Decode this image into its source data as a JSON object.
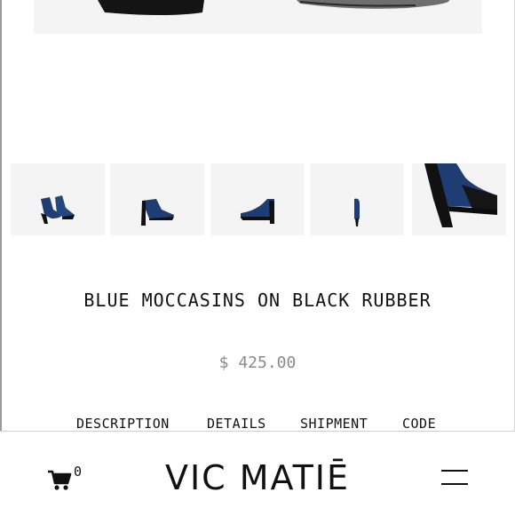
{
  "product": {
    "title": "BLUE MOCCASINS ON BLACK RUBBER",
    "price": "$ 425.00"
  },
  "gallery": {
    "thumbnail_count": 5,
    "colors": {
      "leather_blue": "#1f3c73",
      "rubber_black": "#111111",
      "tile_bg": "#f4f4f4"
    }
  },
  "tabs": [
    {
      "label": "DESCRIPTION"
    },
    {
      "label": "DETAILS"
    },
    {
      "label": "SHIPMENT"
    },
    {
      "label": "CODE"
    }
  ],
  "footer": {
    "cart_icon": "cart-icon",
    "cart_count": "0",
    "brand": "VIC MATIĒ",
    "menu_icon": "hamburger-menu-icon"
  }
}
